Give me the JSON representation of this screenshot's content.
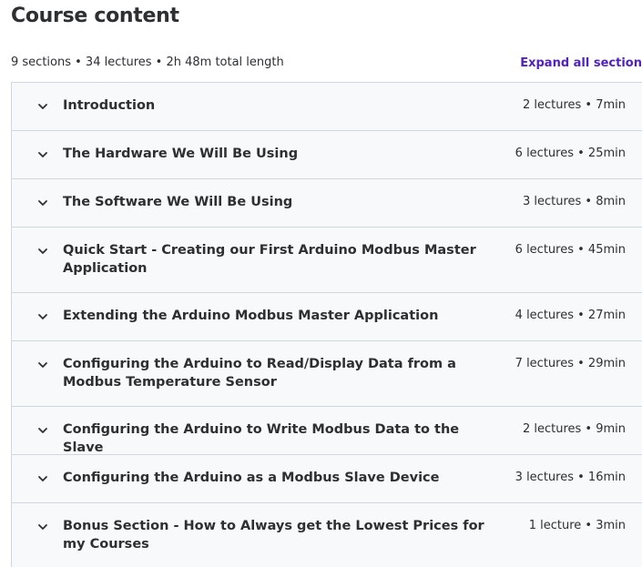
{
  "header": {
    "title": "Course content",
    "summary": "9 sections • 34 lectures • 2h 48m total length",
    "expand_label": "Expand all section"
  },
  "icons": {
    "section_toggle": "chevron-down-icon"
  },
  "colors": {
    "accent": "#5022c3",
    "text": "#2d2f31",
    "row_bg": "#f7f9fa",
    "border": "#d1d7dc"
  },
  "sections": [
    {
      "title": "Introduction",
      "meta": "2 lectures • 7min"
    },
    {
      "title": "The Hardware We Will Be Using",
      "meta": "6 lectures • 25min"
    },
    {
      "title": "The Software We Will Be Using",
      "meta": "3 lectures • 8min"
    },
    {
      "title": "Quick Start - Creating our First Arduino Modbus Master Application",
      "meta": "6 lectures • 45min"
    },
    {
      "title": "Extending the Arduino Modbus Master Application",
      "meta": "4 lectures • 27min"
    },
    {
      "title": "Configuring the Arduino to Read/Display Data from a Modbus Temperature Sensor",
      "meta": "7 lectures • 29min"
    },
    {
      "title": "Configuring the Arduino to Write Modbus Data to the Slave",
      "meta": "2 lectures • 9min"
    },
    {
      "title": "Configuring the Arduino as a Modbus Slave Device",
      "meta": "3 lectures • 16min"
    },
    {
      "title": "Bonus Section - How to Always get the Lowest Prices for my Courses",
      "meta": "1 lecture • 3min"
    }
  ]
}
